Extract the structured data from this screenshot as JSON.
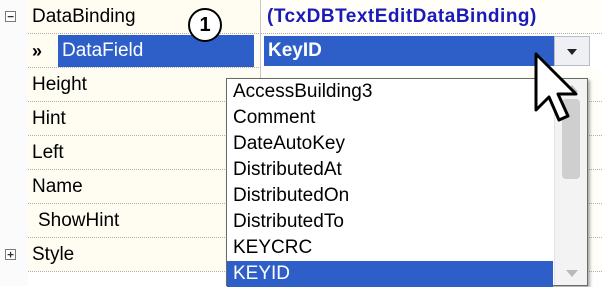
{
  "inspector": {
    "rows": [
      {
        "name": "DataBinding",
        "value": "(TcxDBTextEditDataBinding)",
        "expander": "−"
      },
      {
        "name": "DataField",
        "value": "KeyID"
      },
      {
        "name": "Height"
      },
      {
        "name": "Hint"
      },
      {
        "name": "Left"
      },
      {
        "name": "Name"
      },
      {
        "name": "ShowHint"
      },
      {
        "name": "Style",
        "expander": "+"
      }
    ],
    "selected_marker": "»",
    "callout_number": "1"
  },
  "dropdown": {
    "options": [
      "AccessBuilding3",
      "Comment",
      "DateAutoKey",
      "DistributedAt",
      "DistributedOn",
      "DistributedTo",
      "KEYCRC",
      "KEYID"
    ],
    "selected": "KEYID"
  },
  "icons": {
    "combo_button": "chevron-down-icon",
    "cursor": "mouse-pointer-icon"
  },
  "colors": {
    "selection": "#2e5fc9",
    "property_value_blue": "#1a1ab8"
  }
}
